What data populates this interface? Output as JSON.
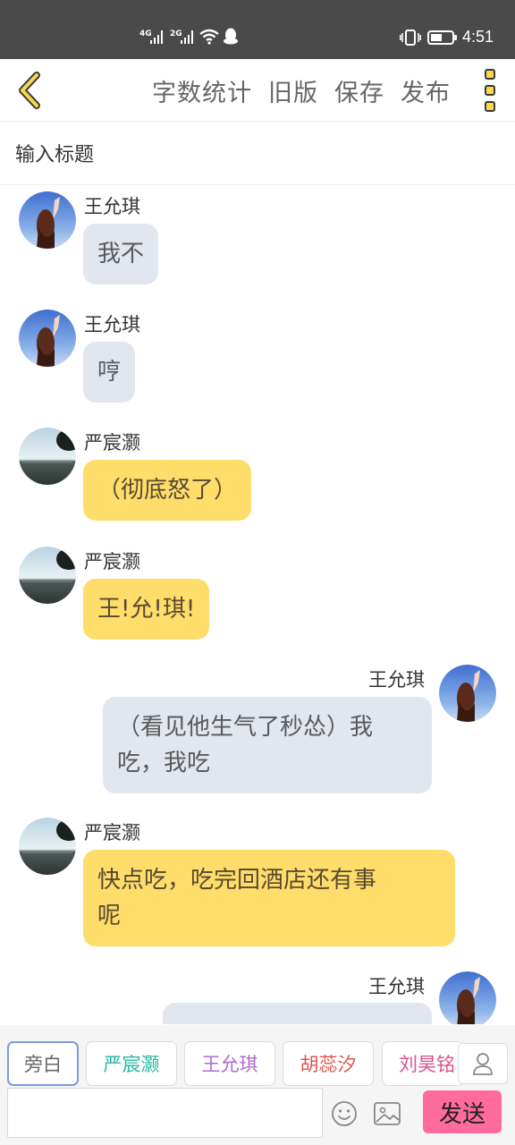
{
  "status_bar": {
    "net1": "4G",
    "net2": "2G",
    "time": "4:51"
  },
  "toolbar": {
    "word_count": "字数统计",
    "old_version": "旧版",
    "save": "保存",
    "publish": "发布"
  },
  "title_input": {
    "placeholder": "输入标题"
  },
  "messages": [
    {
      "side": "left",
      "name": "王允琪",
      "text": "我不",
      "style": "grey"
    },
    {
      "side": "left",
      "name": "王允琪",
      "text": "哼",
      "style": "grey"
    },
    {
      "side": "left",
      "name": "严宸灏",
      "text": "（彻底怒了）",
      "style": "yellow"
    },
    {
      "side": "left",
      "name": "严宸灏",
      "text": "王!允!琪!",
      "style": "yellow"
    },
    {
      "side": "right",
      "name": "王允琪",
      "text_line1": "（看见他生气了秒怂）我",
      "text_line2": "吃，我吃",
      "style": "grey"
    },
    {
      "side": "left",
      "name": "严宸灏",
      "text_line1": "快点吃，吃完回酒店还有事",
      "text_line2": "呢",
      "style": "yellow"
    },
    {
      "side": "right",
      "name": "王允琪",
      "text": "",
      "style": "grey"
    }
  ],
  "roles": [
    {
      "label": "旁白",
      "color": "#666666"
    },
    {
      "label": "严宸灏",
      "color": "#28b5a4"
    },
    {
      "label": "王允琪",
      "color": "#b06ad0"
    },
    {
      "label": "胡蕊汐",
      "color": "#e0554a"
    },
    {
      "label": "刘昊铭",
      "color": "#e0508a"
    }
  ],
  "input_bar": {
    "send": "发送"
  },
  "colors": {
    "accent_yellow": "#fedd6b",
    "bubble_grey": "#e1e6ef",
    "send_pink": "#ff6b9d"
  }
}
